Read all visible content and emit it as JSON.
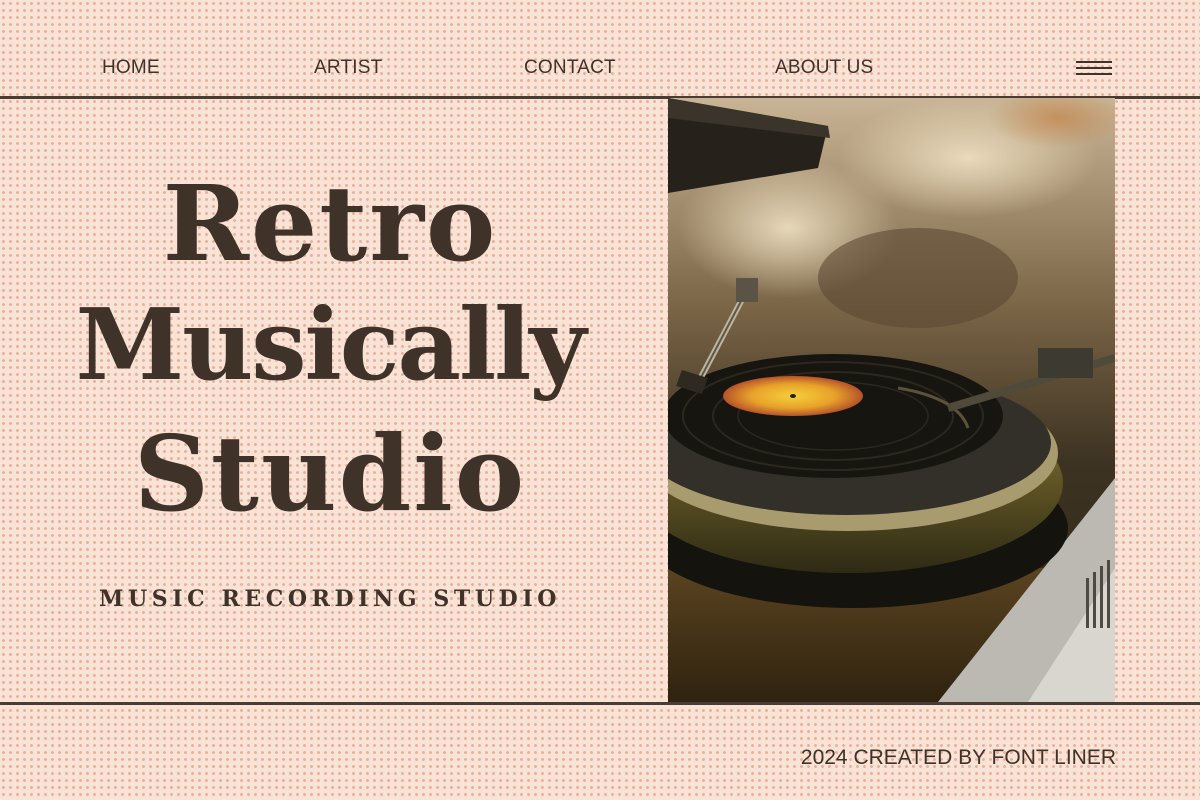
{
  "nav": {
    "items": [
      {
        "label": "HOME"
      },
      {
        "label": "ARTIST"
      },
      {
        "label": "CONTACT"
      },
      {
        "label": "ABOUT US"
      }
    ],
    "menu_icon": "hamburger-menu-icon"
  },
  "hero": {
    "title_line_1": "Retro",
    "title_line_2": "Musically",
    "title_line_3": "Studio",
    "subtitle": "MUSIC RECORDING STUDIO"
  },
  "photo": {
    "subject": "vinyl-turntable-image"
  },
  "footer": {
    "credit": "2024 CREATED BY FONT LINER"
  },
  "colors": {
    "background": "#f8e3d6",
    "dot_pattern": "#e08766",
    "text": "#3e3229",
    "rule": "#4a3c32",
    "label_accent": "#e8a22a"
  }
}
